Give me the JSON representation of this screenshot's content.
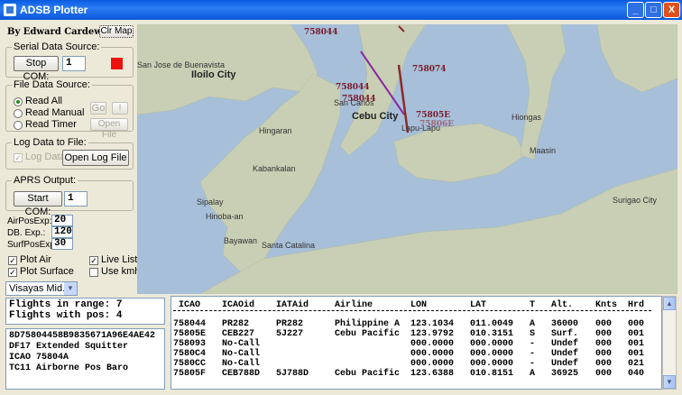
{
  "window": {
    "title": "ADSB Plotter",
    "minimize": "_",
    "maximize": "□",
    "close": "X"
  },
  "left": {
    "author": "By Edward Cardew ©",
    "clr_map": "Clr Map",
    "serial": {
      "title": "Serial Data Source:",
      "button": "Stop COM:",
      "port": "1",
      "status_color": "#ee1010"
    },
    "file": {
      "title": "File Data Source:",
      "options": [
        "Read All",
        "Read Manual",
        "Read Timer"
      ],
      "go": "Go",
      "pause": "!",
      "open": "Open File"
    },
    "log": {
      "title": "Log Data to File:",
      "checkbox": "Log Data",
      "open": "Open Log File"
    },
    "aprs": {
      "title": "APRS Output:",
      "button": "Start COM:",
      "port": "1"
    },
    "exp": {
      "air_label": "AirPosExp:",
      "air_value": "20",
      "db_label": "DB. Exp.:",
      "db_value": "120",
      "surf_label": "SurfPosExp:",
      "surf_value": "30"
    },
    "checks": {
      "plot_air": "Plot Air",
      "plot_surface": "Plot Surface",
      "live_list": "Live List",
      "use_kmh": "Use kmh"
    },
    "region": "Visayas Mid."
  },
  "map": {
    "places": {
      "ilolio": "Iloilo City",
      "cebu": "Cebu City",
      "sancarlos": "San Carlos",
      "hingaran": "Hingaran",
      "kabankalan": "Kabankalan",
      "sipalay": "Sipalay",
      "hinoba": "Hinoba-an",
      "bayawan": "Bayawan",
      "santacat": "Santa Catalina",
      "sanjose": "San Jose de Buenavista",
      "lapu": "Lapu-Lapu",
      "hiongas": "Hiongas",
      "maasin": "Maasin",
      "surigao": "Surigao City"
    },
    "planes": [
      "758044",
      "758074",
      "758044",
      "758044",
      "75805E",
      "75806E"
    ],
    "colors": {
      "water": "#a7bfd8",
      "land": "#c8cfb4",
      "track_a": "#8a2a2a",
      "track_b": "#8a2aa0"
    }
  },
  "info": {
    "line1": "Flights in range: 7",
    "line2": "Flights with pos: 4"
  },
  "message": [
    "8D75804458B9835671A96E4AE42",
    "DF17 Extended Squitter",
    "ICAO 75804A",
    "TC11 Airborne Pos Baro"
  ],
  "table": {
    "columns": [
      "ICAO",
      "ICAOid",
      "IATAid",
      "Airline",
      "LON",
      "LAT",
      "T",
      "Alt.",
      "Knts",
      "Hrd"
    ],
    "rows": [
      [
        "758044",
        "PR282",
        "PR282",
        "Philippine A",
        "123.1034",
        "011.0049",
        "A",
        "36000",
        "000",
        "000"
      ],
      [
        "75805E",
        "CEB227",
        "5J227",
        "Cebu Pacific",
        "123.9792",
        "010.3151",
        "S",
        "Surf.",
        "000",
        "001"
      ],
      [
        "758093",
        "No-Call",
        "",
        "",
        "000.0000",
        "000.0000",
        "-",
        "Undef",
        "000",
        "001"
      ],
      [
        "7580C4",
        "No-Call",
        "",
        "",
        "000.0000",
        "000.0000",
        "-",
        "Undef",
        "000",
        "001"
      ],
      [
        "7580CC",
        "No-Call",
        "",
        "",
        "000.0000",
        "000.0000",
        "-",
        "Undef",
        "000",
        "021"
      ],
      [
        "75805F",
        "CEB788D",
        "5J788D",
        "Cebu Pacific",
        "123.6388",
        "010.8151",
        "A",
        "36925",
        "000",
        "040"
      ]
    ]
  }
}
